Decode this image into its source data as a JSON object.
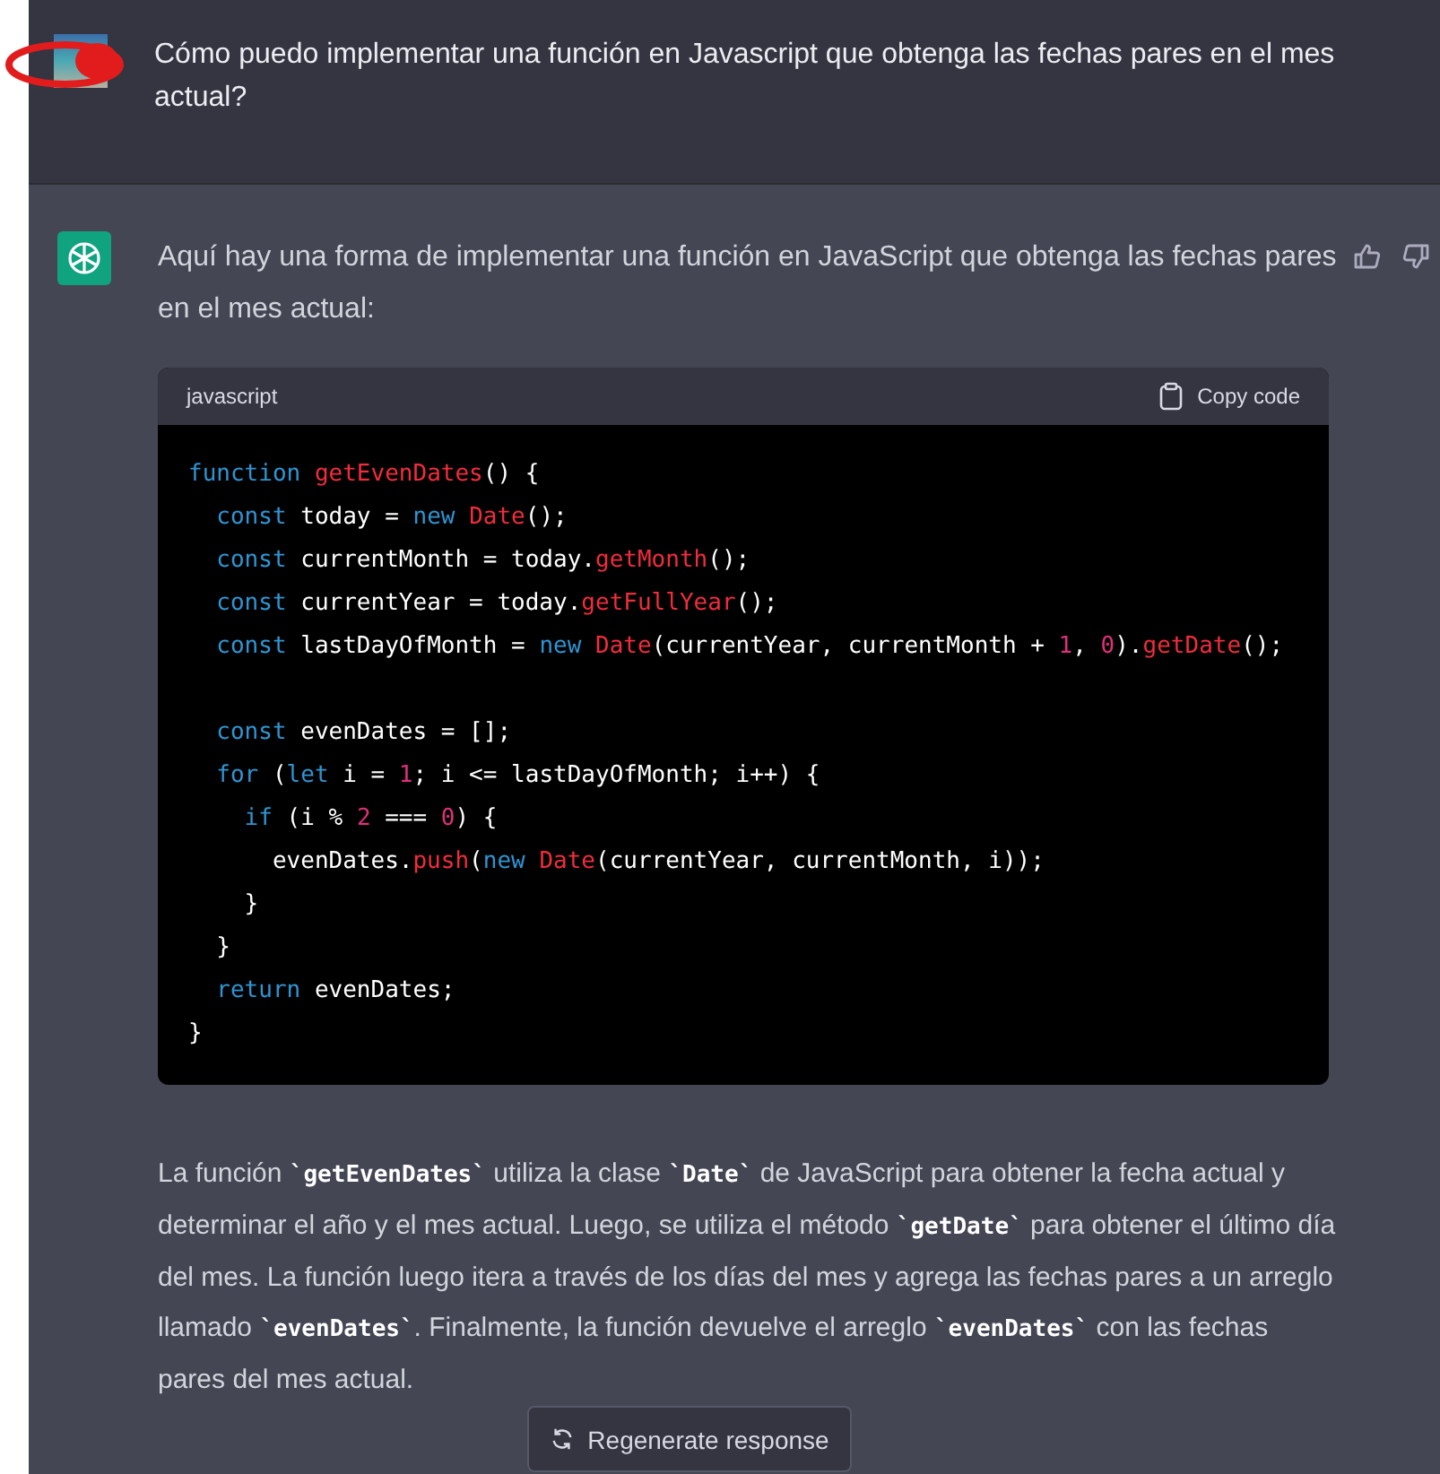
{
  "user_message": {
    "text": "Cómo puedo implementar una función en Javascript que obtenga las fechas pares en el mes actual?"
  },
  "assistant_message": {
    "intro": "Aquí hay una forma de implementar una función en JavaScript que obtenga las fechas pares en el mes actual:",
    "code_block": {
      "language": "javascript",
      "copy_label": "Copy code",
      "lines": [
        {
          "kind": "code",
          "tokens": [
            {
              "kind": "kw",
              "text": "function "
            },
            {
              "kind": "fn",
              "text": "getEvenDates"
            },
            {
              "kind": "plain",
              "text": "() {"
            }
          ]
        },
        {
          "kind": "code",
          "tokens": [
            {
              "kind": "kw",
              "text": "  const "
            },
            {
              "kind": "plain",
              "text": "today = "
            },
            {
              "kind": "kw",
              "text": "new "
            },
            {
              "kind": "fn",
              "text": "Date"
            },
            {
              "kind": "plain",
              "text": "();"
            }
          ]
        },
        {
          "kind": "code",
          "tokens": [
            {
              "kind": "kw",
              "text": "  const "
            },
            {
              "kind": "plain",
              "text": "currentMonth = today."
            },
            {
              "kind": "fn",
              "text": "getMonth"
            },
            {
              "kind": "plain",
              "text": "();"
            }
          ]
        },
        {
          "kind": "code",
          "tokens": [
            {
              "kind": "kw",
              "text": "  const "
            },
            {
              "kind": "plain",
              "text": "currentYear = today."
            },
            {
              "kind": "fn",
              "text": "getFullYear"
            },
            {
              "kind": "plain",
              "text": "();"
            }
          ]
        },
        {
          "kind": "code",
          "tokens": [
            {
              "kind": "kw",
              "text": "  const "
            },
            {
              "kind": "plain",
              "text": "lastDayOfMonth = "
            },
            {
              "kind": "kw",
              "text": "new "
            },
            {
              "kind": "fn",
              "text": "Date"
            },
            {
              "kind": "plain",
              "text": "(currentYear, currentMonth + "
            },
            {
              "kind": "num",
              "text": "1"
            },
            {
              "kind": "plain",
              "text": ", "
            },
            {
              "kind": "num",
              "text": "0"
            },
            {
              "kind": "plain",
              "text": ")."
            },
            {
              "kind": "fn",
              "text": "getDate"
            },
            {
              "kind": "plain",
              "text": "();"
            }
          ]
        },
        {
          "kind": "blank"
        },
        {
          "kind": "code",
          "tokens": [
            {
              "kind": "kw",
              "text": "  const "
            },
            {
              "kind": "plain",
              "text": "evenDates = [];"
            }
          ]
        },
        {
          "kind": "code",
          "tokens": [
            {
              "kind": "kw",
              "text": "  for "
            },
            {
              "kind": "plain",
              "text": "("
            },
            {
              "kind": "kw",
              "text": "let "
            },
            {
              "kind": "plain",
              "text": "i = "
            },
            {
              "kind": "num",
              "text": "1"
            },
            {
              "kind": "plain",
              "text": "; i <= lastDayOfMonth; i++) {"
            }
          ]
        },
        {
          "kind": "code",
          "tokens": [
            {
              "kind": "kw",
              "text": "    if "
            },
            {
              "kind": "plain",
              "text": "(i % "
            },
            {
              "kind": "num",
              "text": "2"
            },
            {
              "kind": "plain",
              "text": " === "
            },
            {
              "kind": "num",
              "text": "0"
            },
            {
              "kind": "plain",
              "text": ") {"
            }
          ]
        },
        {
          "kind": "code",
          "tokens": [
            {
              "kind": "plain",
              "text": "      evenDates."
            },
            {
              "kind": "fn",
              "text": "push"
            },
            {
              "kind": "plain",
              "text": "("
            },
            {
              "kind": "kw",
              "text": "new "
            },
            {
              "kind": "fn",
              "text": "Date"
            },
            {
              "kind": "plain",
              "text": "(currentYear, currentMonth, i));"
            }
          ]
        },
        {
          "kind": "code",
          "tokens": [
            {
              "kind": "plain",
              "text": "    }"
            }
          ]
        },
        {
          "kind": "code",
          "tokens": [
            {
              "kind": "plain",
              "text": "  }"
            }
          ]
        },
        {
          "kind": "code",
          "tokens": [
            {
              "kind": "kw",
              "text": "  return "
            },
            {
              "kind": "plain",
              "text": "evenDates;"
            }
          ]
        },
        {
          "kind": "code",
          "tokens": [
            {
              "kind": "plain",
              "text": "}"
            }
          ]
        }
      ]
    },
    "explanation": "La función **`getEvenDates`** utiliza la clase **`Date`** de JavaScript para obtener la fecha actual y determinar el año y el mes actual. Luego, se utiliza el método **`getDate`** para obtener el último día del mes. La función luego itera a través de los días del mes y agrega las fechas pares a un arreglo llamado **`evenDates`**. Finalmente, la función devuelve el arreglo **`evenDates`** con las fechas pares del mes actual."
  },
  "regenerate_button": {
    "label": "Regenerate response"
  }
}
